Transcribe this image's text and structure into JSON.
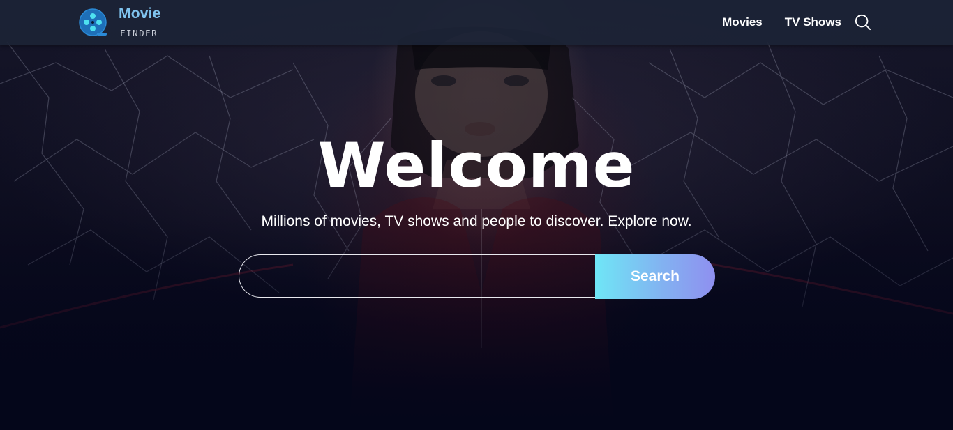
{
  "header": {
    "logo": {
      "title": "Movie",
      "subtitle": "FINDER",
      "icon": "film-reel-icon",
      "color": "#7fc3ee"
    },
    "nav": {
      "movies": "Movies",
      "tv_shows": "TV Shows",
      "search_icon": "search-icon"
    }
  },
  "hero": {
    "title": "Welcome",
    "subtitle": "Millions of movies, TV shows and people to discover. Explore now.",
    "search": {
      "value": "",
      "placeholder": "",
      "button_label": "Search"
    },
    "background": "movie-poster-backdrop",
    "colors": {
      "page_bg": "#04061a",
      "header_bg": "#1c2436",
      "button_gradient_start": "#6fe6f6",
      "button_gradient_end": "#8f8ff0"
    }
  }
}
